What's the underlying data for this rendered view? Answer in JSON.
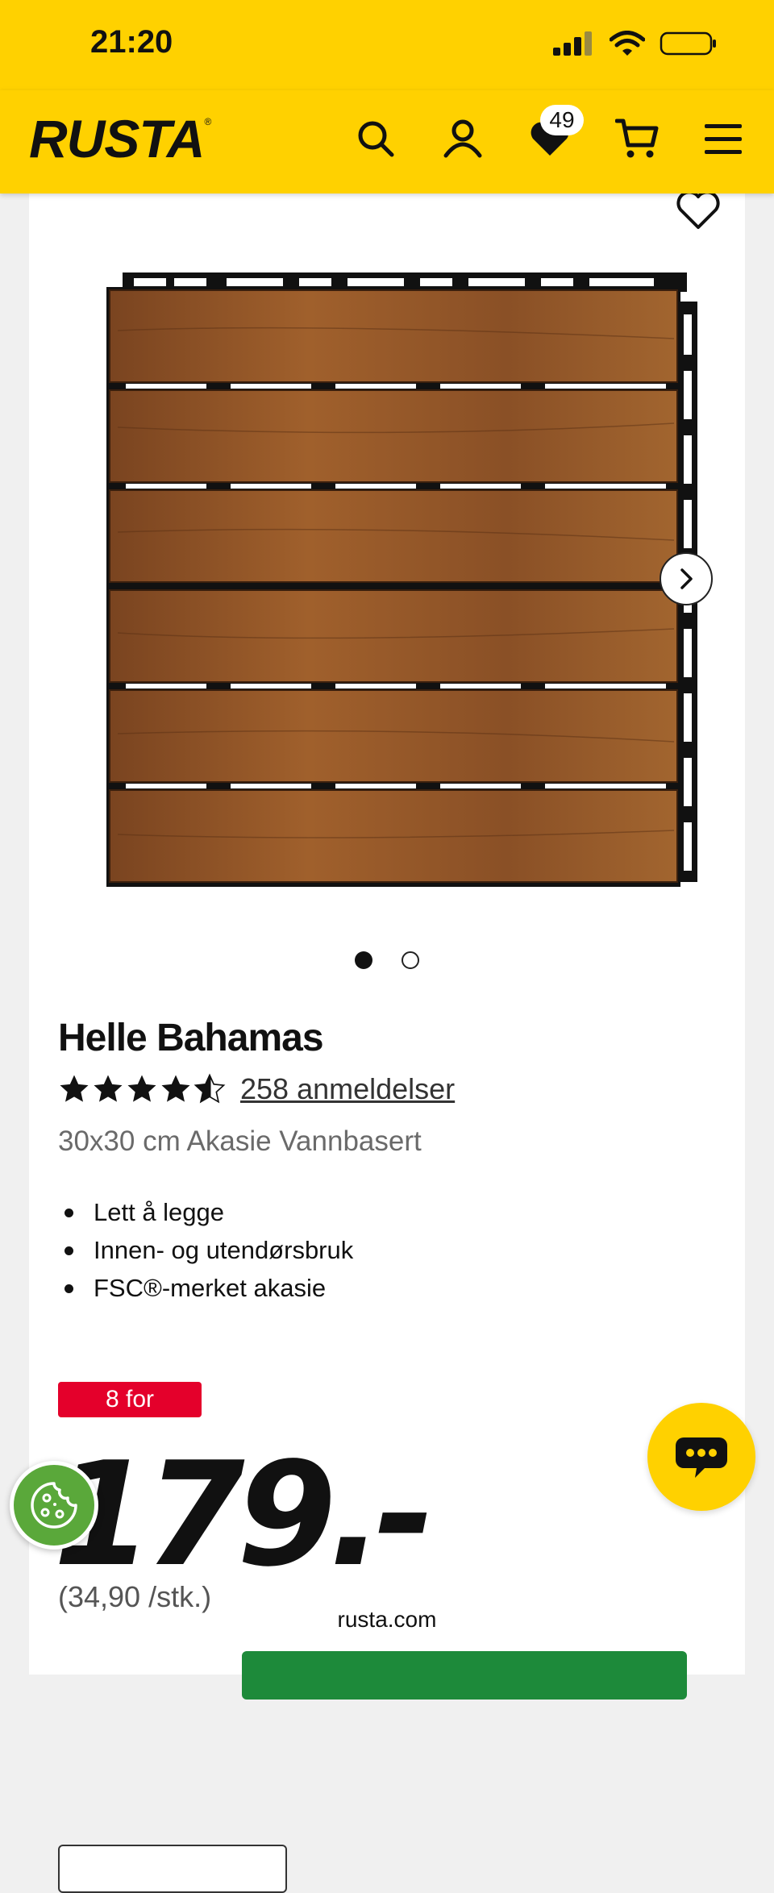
{
  "status_bar": {
    "time": "21:20"
  },
  "header": {
    "logo": "RUSTA",
    "logo_mark": "®",
    "wishlist_count": "49",
    "icons": [
      "search-icon",
      "user-icon",
      "heart-icon",
      "cart-icon",
      "menu-icon"
    ]
  },
  "product": {
    "title": "Helle Bahamas",
    "rating": 4.5,
    "reviews_label": "258 anmeldelser",
    "subtitle": "30x30 cm Akasie Vannbasert",
    "features": [
      "Lett å legge",
      "Innen- og utendørsbruk",
      "FSC®-merket akasie"
    ],
    "promo_badge": "8 for",
    "price": "179.-",
    "unit_price": "(34,90 /stk.)",
    "gallery": {
      "current": 1,
      "total": 2
    }
  },
  "browser": {
    "url": "rusta.com"
  },
  "colors": {
    "brand_yellow": "#ffd100",
    "promo_red": "#e4002b",
    "buy_green": "#1d8a3a",
    "cookie_green": "#5aa83a"
  }
}
